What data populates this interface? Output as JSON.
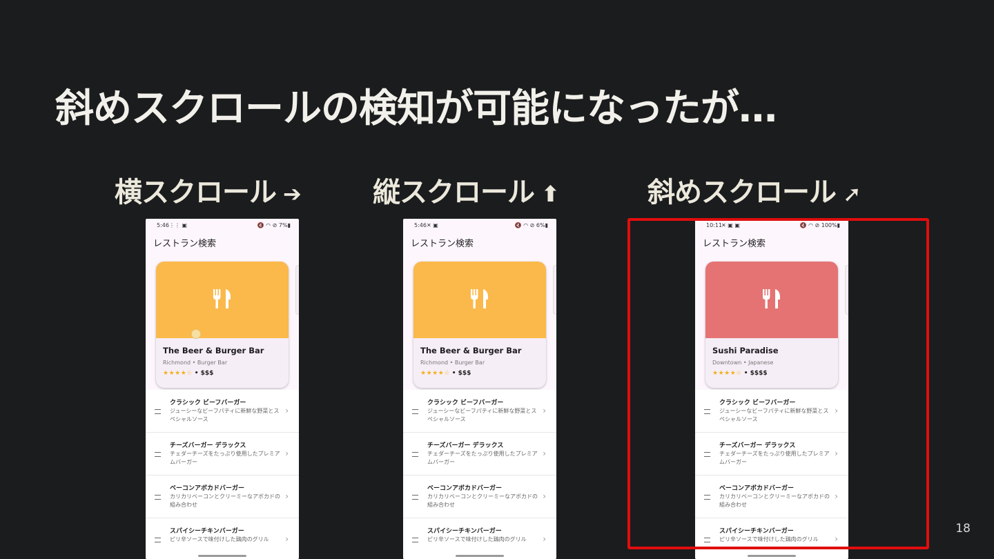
{
  "slide": {
    "title": "斜めスクロールの検知が可能になったが…",
    "page_number": "18",
    "highlight_color": "#e10e0e"
  },
  "columns": [
    {
      "label": "横スクロール",
      "arrow_icon": "arrow-right-icon",
      "arrow_glyph": "➔",
      "phone": {
        "time": "5:46",
        "status_left_icons": "⋮⋮ ▣",
        "status_right": "🔇 ◠ ⊘ 7%▮",
        "app_title": "レストラン検索",
        "card": {
          "name": "The Beer & Burger Bar",
          "subtitle": "Richmond • Burger Bar",
          "stars": "★★★★☆",
          "price": "• $$$",
          "color": "#fbb94b",
          "icon": "restaurant-icon"
        },
        "menu": [
          {
            "name": "クラシック ビーフバーガー",
            "desc": "ジューシーなビーフパティに新鮮な野菜とスペシャルソース"
          },
          {
            "name": "チーズバーガー デラックス",
            "desc": "チェダーチーズをたっぷり使用したプレミアムバーガー"
          },
          {
            "name": "ベーコンアボカドバーガー",
            "desc": "カリカリベーコンとクリーミーなアボカドの組み合わせ"
          },
          {
            "name": "スパイシーチキンバーガー",
            "desc": "ピリ辛ソースで味付けした鶏肉のグリル"
          }
        ]
      }
    },
    {
      "label": "縦スクロール",
      "arrow_icon": "arrow-up-icon",
      "arrow_glyph": "⬆",
      "phone": {
        "time": "5:46",
        "status_left_icons": "✕ ▣",
        "status_right": "🔇 ◠ ⊘ 6%▮",
        "app_title": "レストラン検索",
        "card": {
          "name": "The Beer & Burger Bar",
          "subtitle": "Richmond • Burger Bar",
          "stars": "★★★★☆",
          "price": "• $$$",
          "color": "#fbb94b",
          "icon": "restaurant-icon"
        },
        "menu": [
          {
            "name": "クラシック ビーフバーガー",
            "desc": "ジューシーなビーフパティに新鮮な野菜とスペシャルソース"
          },
          {
            "name": "チーズバーガー デラックス",
            "desc": "チェダーチーズをたっぷり使用したプレミアムバーガー"
          },
          {
            "name": "ベーコンアボカドバーガー",
            "desc": "カリカリベーコンとクリーミーなアボカドの組み合わせ"
          },
          {
            "name": "スパイシーチキンバーガー",
            "desc": "ピリ辛ソースで味付けした鶏肉のグリル"
          }
        ]
      }
    },
    {
      "label": "斜めスクロール",
      "arrow_icon": "arrow-up-right-icon",
      "arrow_glyph": "➚",
      "phone": {
        "time": "10:11",
        "status_left_icons": "✕ ▣ ▣",
        "status_right": "🔇 ◠ ⊘ 100%▮",
        "app_title": "レストラン検索",
        "card": {
          "name": "Sushi Paradise",
          "subtitle": "Downtown • Japanese",
          "stars": "★★★★☆",
          "price": "• $$$$",
          "color": "#e57373",
          "icon": "restaurant-icon"
        },
        "menu": [
          {
            "name": "クラシック ビーフバーガー",
            "desc": "ジューシーなビーフパティに新鮮な野菜とスペシャルソース"
          },
          {
            "name": "チーズバーガー デラックス",
            "desc": "チェダーチーズをたっぷり使用したプレミアムバーガー"
          },
          {
            "name": "ベーコンアボカドバーガー",
            "desc": "カリカリベーコンとクリーミーなアボカドの組み合わせ"
          },
          {
            "name": "スパイシーチキンバーガー",
            "desc": "ピリ辛ソースで味付けした鶏肉のグリル"
          }
        ]
      }
    }
  ]
}
